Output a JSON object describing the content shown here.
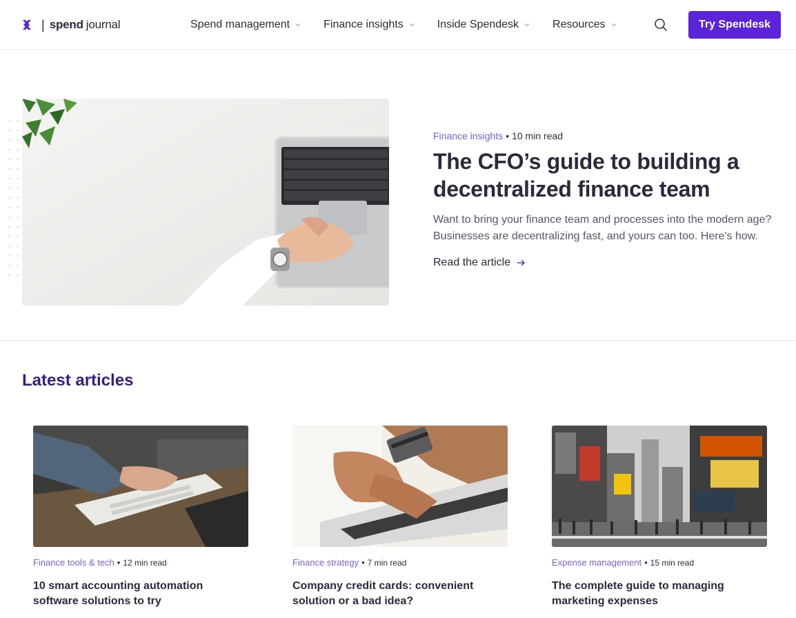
{
  "header": {
    "logo_bold": "spend",
    "logo_light": "journal",
    "logo_separator": "|",
    "nav": [
      {
        "label": "Spend management"
      },
      {
        "label": "Finance insights"
      },
      {
        "label": "Inside Spendesk"
      },
      {
        "label": "Resources"
      }
    ],
    "search_icon": "search-icon",
    "cta_label": "Try Spendesk"
  },
  "hero": {
    "category": "Finance insights",
    "separator": "•",
    "read_time": "10 min read",
    "title": "The CFO’s guide to building a decentralized finance team",
    "description": "Want to bring your finance team and processes into the modern age? Businesses are decentralizing fast, and yours can too. Here's how.",
    "link_label": "Read the article",
    "link_icon": "arrow-right-icon"
  },
  "latest": {
    "heading": "Latest articles",
    "articles": [
      {
        "category": "Finance tools & tech",
        "separator": "•",
        "read_time": "12 min read",
        "title": "10 smart accounting automation software solutions to try"
      },
      {
        "category": "Finance strategy",
        "separator": "•",
        "read_time": "7 min read",
        "title": "Company credit cards: convenient solution or a bad idea?"
      },
      {
        "category": "Expense management",
        "separator": "•",
        "read_time": "15 min read",
        "title": "The complete guide to managing marketing expenses"
      }
    ]
  },
  "colors": {
    "brand": "#5b24d6",
    "category": "#7d5ce0",
    "heading": "#3a1d84",
    "text": "#2b2a3d"
  }
}
